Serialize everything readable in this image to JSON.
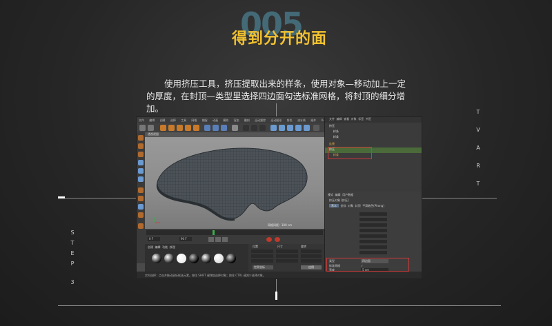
{
  "header": {
    "step_number": "005",
    "title": "得到分开的面"
  },
  "description": "使用挤压工具，挤压提取出来的样条，使用对象—移动加上一定的厚度，在封顶—类型里选择四边面勾选标准网格，将封顶的细分增加。",
  "side_right_letters": [
    "T",
    "V",
    "A",
    "R",
    "T"
  ],
  "side_left_letters": [
    "S",
    "T",
    "E",
    "P",
    "3"
  ],
  "screenshot": {
    "menubar": [
      "文件",
      "编辑",
      "创建",
      "选择",
      "工具",
      "网格",
      "捕捉",
      "动画",
      "模拟",
      "渲染",
      "雕刻",
      "运动跟踪",
      "运动图形",
      "角色",
      "流水线",
      "插件",
      "X-Particles",
      "脚本",
      "窗口",
      "帮助"
    ],
    "viewport_label": "透视视图",
    "viewport_info": "网格间距：100 cm",
    "object_manager": {
      "tabs": [
        "文件",
        "编辑",
        "查看",
        "对象",
        "标签",
        "书签"
      ],
      "rows": [
        "挤压",
        "样条",
        "样条",
        "连接",
        "挤压",
        "样条"
      ]
    },
    "attribute_manager": {
      "tabs": [
        "模式",
        "编辑",
        "用户数据"
      ],
      "object_title": "挤压对象 [挤压]",
      "subtabs": [
        "基本",
        "坐标",
        "对象",
        "封顶",
        "平滑着色(Phong)"
      ],
      "highlight_fields": [
        "类型",
        "标准网格",
        "宽度"
      ],
      "highlight_values": [
        "四边面",
        "✓",
        "5 cm"
      ]
    },
    "coords": {
      "headers": [
        "位置",
        "尺寸",
        "旋转"
      ],
      "apply_button": "应用",
      "world_select": "世界坐标"
    },
    "timeline": {
      "start": "0 F",
      "end": "90 F"
    },
    "materials_tabs": [
      "创建",
      "编辑",
      "功能",
      "纹理"
    ],
    "status": "实时选择：点击并拖动鼠标框选元素。按住 SHIFT 键增加选择对象；按住 CTRL 键减少选择对象。"
  },
  "colors": {
    "title": "#f2c230",
    "step_number": "#4a7d8e",
    "highlight_border": "#d23a3a"
  }
}
